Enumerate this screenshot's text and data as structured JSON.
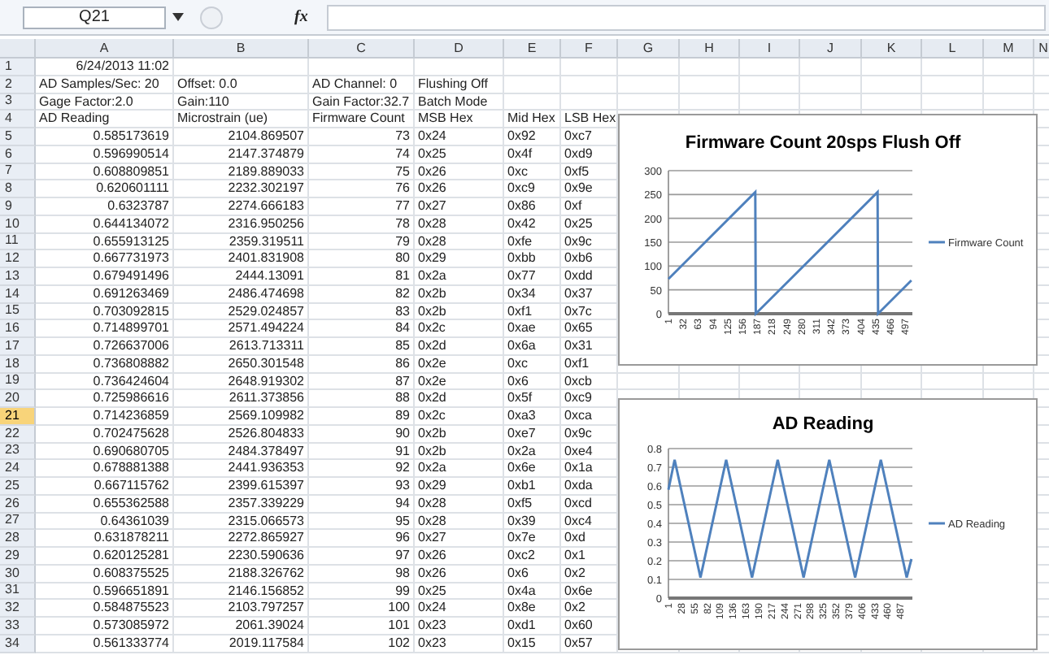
{
  "formula_bar": {
    "name_box": "Q21",
    "fx_label": "fx"
  },
  "columns": [
    "A",
    "B",
    "C",
    "D",
    "E",
    "F",
    "G",
    "H",
    "I",
    "J",
    "K",
    "L",
    "M",
    "N"
  ],
  "rows": [
    {
      "number": "1",
      "selected": false,
      "kind": "date",
      "cells": [
        "6/24/2013 11:02"
      ]
    },
    {
      "number": "2",
      "selected": false,
      "kind": "text",
      "cells": [
        "AD Samples/Sec: 20",
        "Offset: 0.0",
        "AD Channel: 0",
        "Flushing Off"
      ]
    },
    {
      "number": "3",
      "selected": false,
      "kind": "text",
      "cells": [
        "Gage Factor:2.0",
        "Gain:110",
        "Gain Factor:32.7",
        "Batch Mode"
      ]
    },
    {
      "number": "4",
      "selected": false,
      "kind": "text",
      "cells": [
        "AD Reading",
        "Microstrain (ue)",
        "Firmware Count",
        "MSB Hex",
        "Mid Hex",
        "LSB Hex"
      ]
    },
    {
      "number": "5",
      "selected": false,
      "kind": "data",
      "cells": [
        "0.585173619",
        "2104.869507",
        "73",
        "0x24",
        "0x92",
        "0xc7"
      ]
    },
    {
      "number": "6",
      "selected": false,
      "kind": "data",
      "cells": [
        "0.596990514",
        "2147.374879",
        "74",
        "0x25",
        "0x4f",
        "0xd9"
      ]
    },
    {
      "number": "7",
      "selected": false,
      "kind": "data",
      "cells": [
        "0.608809851",
        "2189.889033",
        "75",
        "0x26",
        "0xc",
        "0xf5"
      ]
    },
    {
      "number": "8",
      "selected": false,
      "kind": "data",
      "cells": [
        "0.620601111",
        "2232.302197",
        "76",
        "0x26",
        "0xc9",
        "0x9e"
      ]
    },
    {
      "number": "9",
      "selected": false,
      "kind": "data",
      "cells": [
        "0.6323787",
        "2274.666183",
        "77",
        "0x27",
        "0x86",
        "0xf"
      ]
    },
    {
      "number": "10",
      "selected": false,
      "kind": "data",
      "cells": [
        "0.644134072",
        "2316.950256",
        "78",
        "0x28",
        "0x42",
        "0x25"
      ]
    },
    {
      "number": "11",
      "selected": false,
      "kind": "data",
      "cells": [
        "0.655913125",
        "2359.319511",
        "79",
        "0x28",
        "0xfe",
        "0x9c"
      ]
    },
    {
      "number": "12",
      "selected": false,
      "kind": "data",
      "cells": [
        "0.667731973",
        "2401.831908",
        "80",
        "0x29",
        "0xbb",
        "0xb6"
      ]
    },
    {
      "number": "13",
      "selected": false,
      "kind": "data",
      "cells": [
        "0.679491496",
        "2444.13091",
        "81",
        "0x2a",
        "0x77",
        "0xdd"
      ]
    },
    {
      "number": "14",
      "selected": false,
      "kind": "data",
      "cells": [
        "0.691263469",
        "2486.474698",
        "82",
        "0x2b",
        "0x34",
        "0x37"
      ]
    },
    {
      "number": "15",
      "selected": false,
      "kind": "data",
      "cells": [
        "0.703092815",
        "2529.024857",
        "83",
        "0x2b",
        "0xf1",
        "0x7c"
      ]
    },
    {
      "number": "16",
      "selected": false,
      "kind": "data",
      "cells": [
        "0.714899701",
        "2571.494224",
        "84",
        "0x2c",
        "0xae",
        "0x65"
      ]
    },
    {
      "number": "17",
      "selected": false,
      "kind": "data",
      "cells": [
        "0.726637006",
        "2613.713311",
        "85",
        "0x2d",
        "0x6a",
        "0x31"
      ]
    },
    {
      "number": "18",
      "selected": false,
      "kind": "data",
      "cells": [
        "0.736808882",
        "2650.301548",
        "86",
        "0x2e",
        "0xc",
        "0xf1"
      ]
    },
    {
      "number": "19",
      "selected": false,
      "kind": "data",
      "cells": [
        "0.736424604",
        "2648.919302",
        "87",
        "0x2e",
        "0x6",
        "0xcb"
      ]
    },
    {
      "number": "20",
      "selected": false,
      "kind": "data",
      "cells": [
        "0.725986616",
        "2611.373856",
        "88",
        "0x2d",
        "0x5f",
        "0xc9"
      ]
    },
    {
      "number": "21",
      "selected": true,
      "kind": "data",
      "cells": [
        "0.714236859",
        "2569.109982",
        "89",
        "0x2c",
        "0xa3",
        "0xca"
      ]
    },
    {
      "number": "22",
      "selected": false,
      "kind": "data",
      "cells": [
        "0.702475628",
        "2526.804833",
        "90",
        "0x2b",
        "0xe7",
        "0x9c"
      ]
    },
    {
      "number": "23",
      "selected": false,
      "kind": "data",
      "cells": [
        "0.690680705",
        "2484.378497",
        "91",
        "0x2b",
        "0x2a",
        "0xe4"
      ]
    },
    {
      "number": "24",
      "selected": false,
      "kind": "data",
      "cells": [
        "0.678881388",
        "2441.936353",
        "92",
        "0x2a",
        "0x6e",
        "0x1a"
      ]
    },
    {
      "number": "25",
      "selected": false,
      "kind": "data",
      "cells": [
        "0.667115762",
        "2399.615397",
        "93",
        "0x29",
        "0xb1",
        "0xda"
      ]
    },
    {
      "number": "26",
      "selected": false,
      "kind": "data",
      "cells": [
        "0.655362588",
        "2357.339229",
        "94",
        "0x28",
        "0xf5",
        "0xcd"
      ]
    },
    {
      "number": "27",
      "selected": false,
      "kind": "data",
      "cells": [
        "0.64361039",
        "2315.066573",
        "95",
        "0x28",
        "0x39",
        "0xc4"
      ]
    },
    {
      "number": "28",
      "selected": false,
      "kind": "data",
      "cells": [
        "0.631878211",
        "2272.865927",
        "96",
        "0x27",
        "0x7e",
        "0xd"
      ]
    },
    {
      "number": "29",
      "selected": false,
      "kind": "data",
      "cells": [
        "0.620125281",
        "2230.590636",
        "97",
        "0x26",
        "0xc2",
        "0x1"
      ]
    },
    {
      "number": "30",
      "selected": false,
      "kind": "data",
      "cells": [
        "0.608375525",
        "2188.326762",
        "98",
        "0x26",
        "0x6",
        "0x2"
      ]
    },
    {
      "number": "31",
      "selected": false,
      "kind": "data",
      "cells": [
        "0.596651891",
        "2146.156852",
        "99",
        "0x25",
        "0x4a",
        "0x6e"
      ]
    },
    {
      "number": "32",
      "selected": false,
      "kind": "data",
      "cells": [
        "0.584875523",
        "2103.797257",
        "100",
        "0x24",
        "0x8e",
        "0x2"
      ]
    },
    {
      "number": "33",
      "selected": false,
      "kind": "data",
      "cells": [
        "0.573085972",
        "2061.39024",
        "101",
        "0x23",
        "0xd1",
        "0x60"
      ]
    },
    {
      "number": "34",
      "selected": false,
      "kind": "data",
      "cells": [
        "0.561333774",
        "2019.117584",
        "102",
        "0x23",
        "0x15",
        "0x57"
      ]
    }
  ],
  "charts": [
    {
      "chart_data": {
        "type": "line",
        "title": "Firmware Count 20sps Flush Off",
        "x": [
          1,
          183,
          184,
          439,
          440,
          510
        ],
        "xlim": [
          1,
          512
        ],
        "ylim": [
          0,
          300
        ],
        "grid": true,
        "series": [
          {
            "name": "Firmware Count",
            "color": "#4f81bd",
            "values": [
              73,
              255,
              0,
              255,
              0,
              70
            ]
          }
        ],
        "xticks": [
          1,
          32,
          63,
          94,
          125,
          156,
          187,
          218,
          249,
          280,
          311,
          342,
          373,
          404,
          435,
          466,
          497
        ],
        "yticks": [
          0,
          50,
          100,
          150,
          200,
          250,
          300
        ]
      }
    },
    {
      "chart_data": {
        "type": "line",
        "title": "AD Reading",
        "x": [
          1,
          14,
          68,
          122,
          176,
          230,
          284,
          338,
          392,
          446,
          500,
          510
        ],
        "xlim": [
          1,
          512
        ],
        "ylim": [
          0,
          0.8
        ],
        "grid": true,
        "series": [
          {
            "name": "AD Reading",
            "color": "#4f81bd",
            "values": [
              0.58,
              0.74,
              0.11,
              0.74,
              0.11,
              0.74,
              0.11,
              0.74,
              0.11,
              0.74,
              0.11,
              0.21
            ]
          }
        ],
        "xticks": [
          1,
          28,
          55,
          82,
          109,
          136,
          163,
          190,
          217,
          244,
          271,
          298,
          325,
          352,
          379,
          406,
          433,
          460,
          487
        ],
        "yticks": [
          0,
          0.1,
          0.2,
          0.3,
          0.4,
          0.5,
          0.6,
          0.7,
          0.8
        ]
      }
    }
  ]
}
